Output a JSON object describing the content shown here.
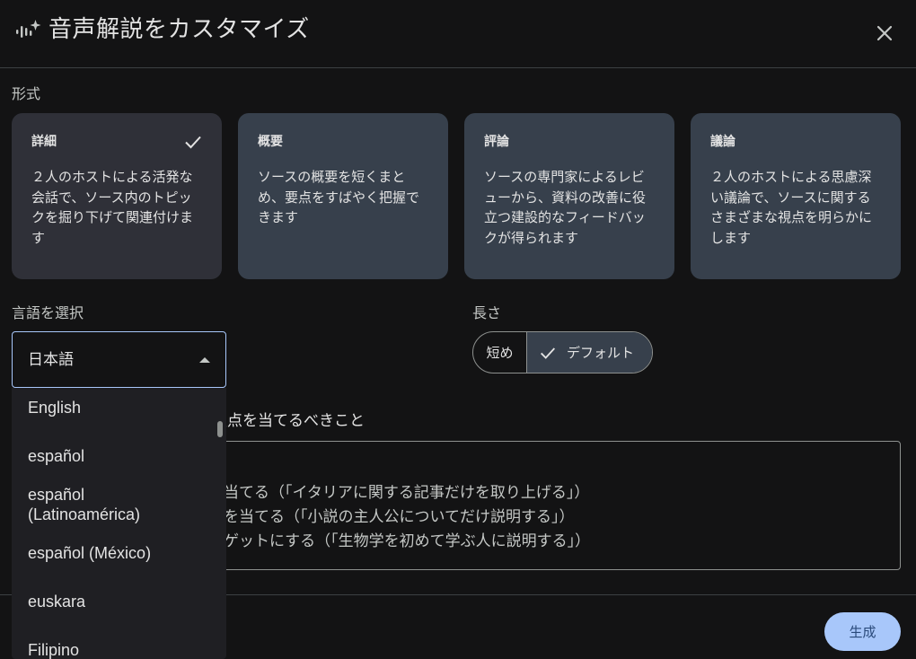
{
  "header": {
    "title": "音声解説をカスタマイズ",
    "icon": "audio-sparkle-icon",
    "close_icon": "close-icon"
  },
  "format": {
    "label": "形式",
    "cards": [
      {
        "title": "詳細",
        "lines": [
          "２人のホストによる活発な",
          "会話で、ソース内のトピッ",
          "クを掘り下げて関連付けま",
          "す"
        ],
        "selected": true
      },
      {
        "title": "概要",
        "lines": [
          "ソースの概要を短くまと",
          "め、要点をすばやく把握で",
          "きます"
        ],
        "selected": false
      },
      {
        "title": "評論",
        "lines": [
          "ソースの専門家によるレビ",
          "ューから、資料の改善に役",
          "立つ建設的なフィードバッ",
          "クが得られます"
        ],
        "selected": false
      },
      {
        "title": "議論",
        "lines": [
          "２人のホストによる思慮深",
          "い議論で、ソースに関する",
          "さまざまな視点を明らかに",
          "します"
        ],
        "selected": false
      }
    ]
  },
  "language": {
    "label": "言語を選択",
    "selected": "日本語",
    "options": [
      "English",
      "español",
      "español",
      "(Latinoamérica)",
      "español (México)",
      "euskara",
      "Filipino"
    ]
  },
  "length": {
    "label": "長さ",
    "short": "短め",
    "default": "デフォルト"
  },
  "focus": {
    "label_visible": "焦点を当てるべきこと",
    "hints": [
      "を当てる（「イタリアに関する記事だけを取り上げる」）",
      "点を当てる（「小説の主人公についてだけ説明する」）",
      "ーゲットにする（「生物学を初めて学ぶ人に説明する」）"
    ]
  },
  "footer": {
    "generate": "生成"
  },
  "colors": {
    "accent": "#a8c7fa",
    "card": "#37404c",
    "card_selected": "#2f3038",
    "background": "#131314"
  }
}
